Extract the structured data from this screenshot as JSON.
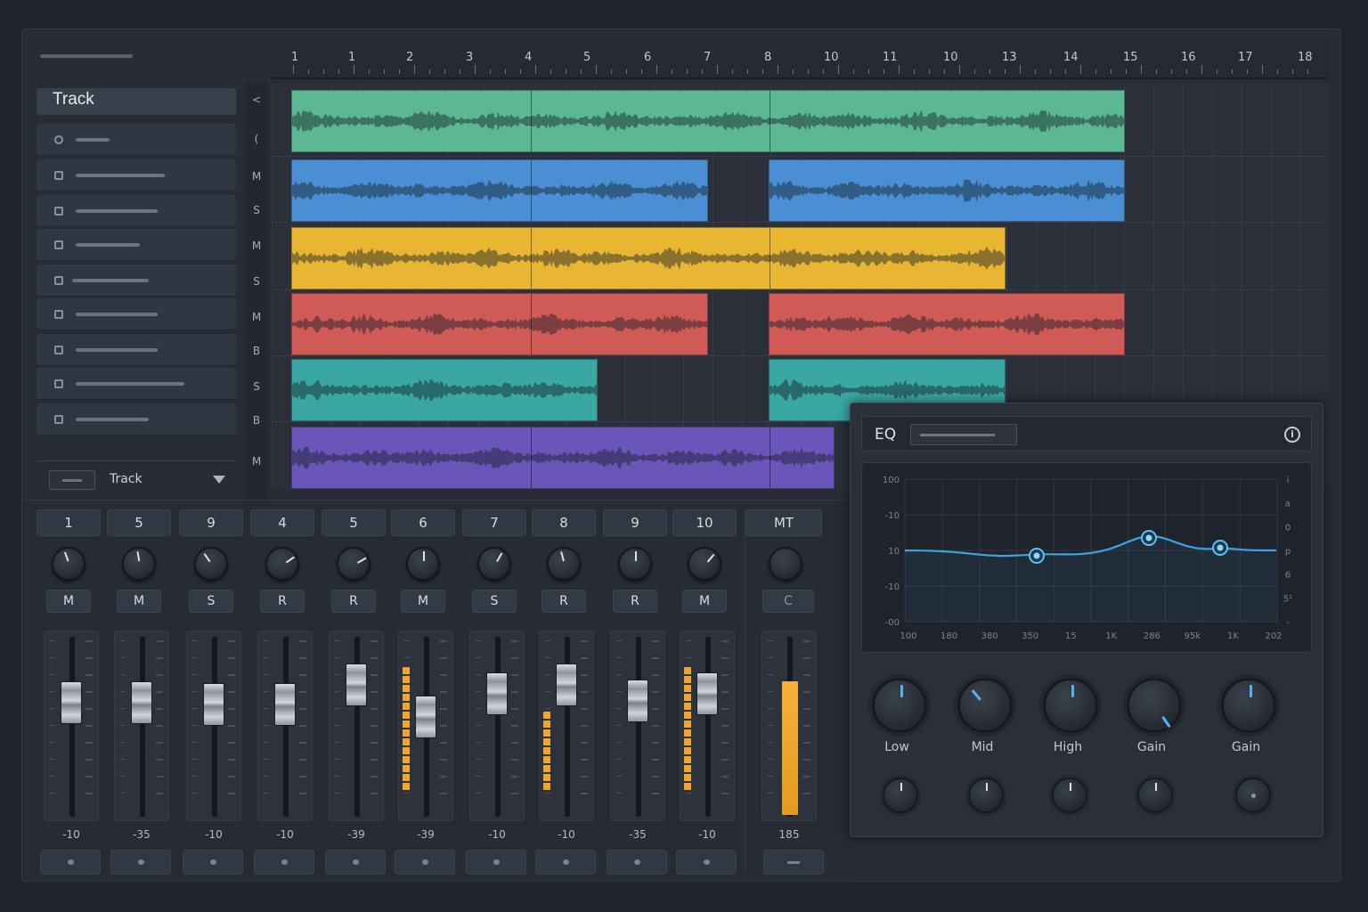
{
  "ruler": {
    "labels": [
      "1",
      "1",
      "2",
      "3",
      "4",
      "5",
      "6",
      "7",
      "8",
      "10",
      "11",
      "10",
      "13",
      "14",
      "15",
      "16",
      "17",
      "18"
    ]
  },
  "sidebar": {
    "title": "Track",
    "footer_label": "Track",
    "right_strip": [
      "<",
      "(",
      "M",
      "S",
      "M",
      "S",
      "M",
      "B",
      "S",
      "B",
      "M"
    ]
  },
  "tracks": [
    {
      "color": "#5cb892"
    },
    {
      "color": "#4a8fd4"
    },
    {
      "color": "#e9b634"
    },
    {
      "color": "#cf5a56"
    },
    {
      "color": "#3aa7a3"
    },
    {
      "color": "#6956b8"
    }
  ],
  "mixer": {
    "channels": [
      {
        "num": "1",
        "mode": "M",
        "db": "-10"
      },
      {
        "num": "5",
        "mode": "M",
        "db": "-35"
      },
      {
        "num": "9",
        "mode": "S",
        "db": "-10"
      },
      {
        "num": "4",
        "mode": "R",
        "db": "-10"
      },
      {
        "num": "5",
        "mode": "R",
        "db": "-39"
      },
      {
        "num": "6",
        "mode": "M",
        "db": "-39"
      },
      {
        "num": "7",
        "mode": "S",
        "db": "-10"
      },
      {
        "num": "8",
        "mode": "R",
        "db": "-10"
      },
      {
        "num": "9",
        "mode": "R",
        "db": "-35"
      },
      {
        "num": "10",
        "mode": "M",
        "db": "-10"
      }
    ],
    "master": {
      "num": "MT",
      "mode": "C",
      "db": "185"
    }
  },
  "eq": {
    "title": "EQ",
    "info_icon": "i",
    "y_labels": [
      "100",
      "-10",
      "10",
      "-10",
      "-00"
    ],
    "x_labels": [
      "100",
      "180",
      "380",
      "350",
      "15",
      "1K",
      "286",
      "95k",
      "1K",
      "202"
    ],
    "right_labels": [
      "i",
      "a",
      "0",
      "p",
      "6",
      "5¹",
      "-"
    ],
    "knobs": [
      "Low",
      "Mid",
      "High",
      "Gain",
      "Gain"
    ],
    "curve_color": "#3ea3dc"
  }
}
